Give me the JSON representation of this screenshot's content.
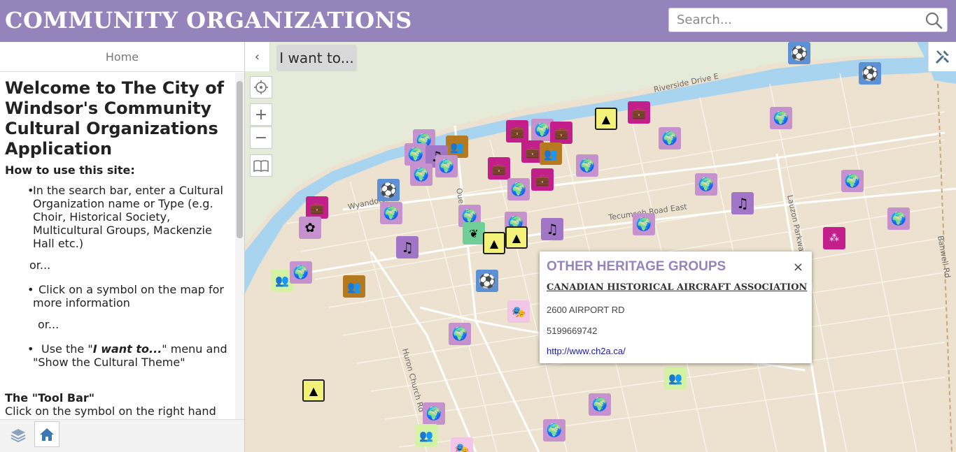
{
  "header": {
    "title": "COMMUNITY ORGANIZATIONS",
    "search_placeholder": "Search...",
    "color": "#9583bb"
  },
  "panel": {
    "tab_label": "Home",
    "welcome_heading": "Welcome to The City of Windsor's Community Cultural Organizations Application",
    "howto_heading": "How to use this site:",
    "step1": "In the search bar, enter a Cultural Organization name or Type (e.g. Choir, Historical Society, Multicultural Groups, Mackenzie Hall etc.)",
    "or1": "or...",
    "step2": "Click on a symbol on the map for more information",
    "or2": "or...",
    "step3_pre": "Use the \"",
    "step3_em": "I want to...",
    "step3_post": "\" menu and \"Show the Cultural Theme\"",
    "toolbar_heading": "The \"Tool Bar\"",
    "toolbar_text": "Click on the symbol on the right hand",
    "footer": {
      "layers_icon": "layers-icon",
      "home_icon": "home-icon"
    }
  },
  "map": {
    "i_want_to": "I want to...",
    "labels": {
      "riverside": "Riverside Drive E",
      "wyandotte": "Wyandotte St",
      "tecumseh": "Tecumseh Road East",
      "lauzon": "Lauzon Parkway",
      "huron": "Huron Church Rd",
      "banwell": "Banwell Rd",
      "ouellette": "Oue"
    },
    "controls": [
      "locate-icon",
      "zoom-in-icon",
      "zoom-out-icon",
      "bookmark-icon"
    ]
  },
  "popup": {
    "title": "OTHER HERITAGE GROUPS",
    "close": "×",
    "name": "CANADIAN HISTORICAL AIRCRAFT ASSOCIATION",
    "address": "2600 AIRPORT RD",
    "phone": "5199669742",
    "url": "http://www.ch2a.ca/"
  }
}
